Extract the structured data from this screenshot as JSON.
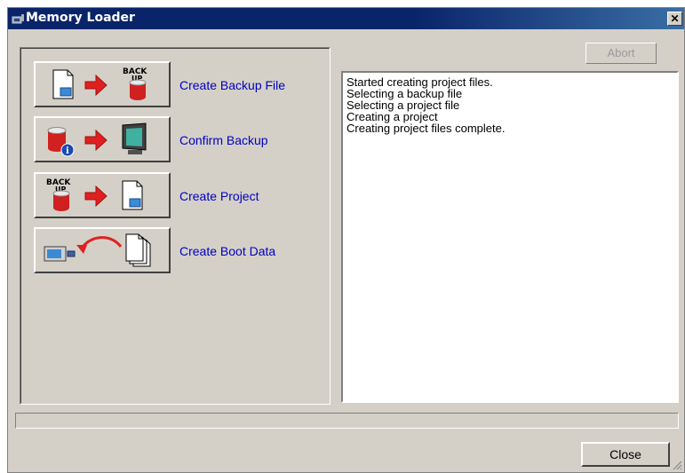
{
  "window": {
    "title": "Memory Loader",
    "close_glyph": "✕"
  },
  "actions": [
    {
      "label": "Create Backup File",
      "icons": [
        "document-icon",
        "arrow-right-icon",
        "backup-database-icon"
      ]
    },
    {
      "label": "Confirm Backup",
      "icons": [
        "database-info-icon",
        "arrow-right-icon",
        "monitor-icon"
      ]
    },
    {
      "label": "Create Project",
      "icons": [
        "backup-database-icon",
        "arrow-right-icon",
        "document-icon"
      ]
    },
    {
      "label": "Create Boot Data",
      "icons": [
        "display-unit-icon",
        "curved-arrow-icon",
        "documents-stack-icon"
      ]
    }
  ],
  "abort_button": {
    "label": "Abort",
    "enabled": false
  },
  "log": {
    "lines": [
      "Started creating project files.",
      "Selecting a backup file",
      "Selecting a project file",
      "Creating a project",
      "Creating project files complete."
    ]
  },
  "progress": {
    "value": 0
  },
  "close_button": {
    "label": "Close"
  },
  "colors": {
    "title_bar": "#0a246a",
    "link": "#0000c0",
    "face": "#d4d0c8",
    "arrow": "#e02020"
  }
}
